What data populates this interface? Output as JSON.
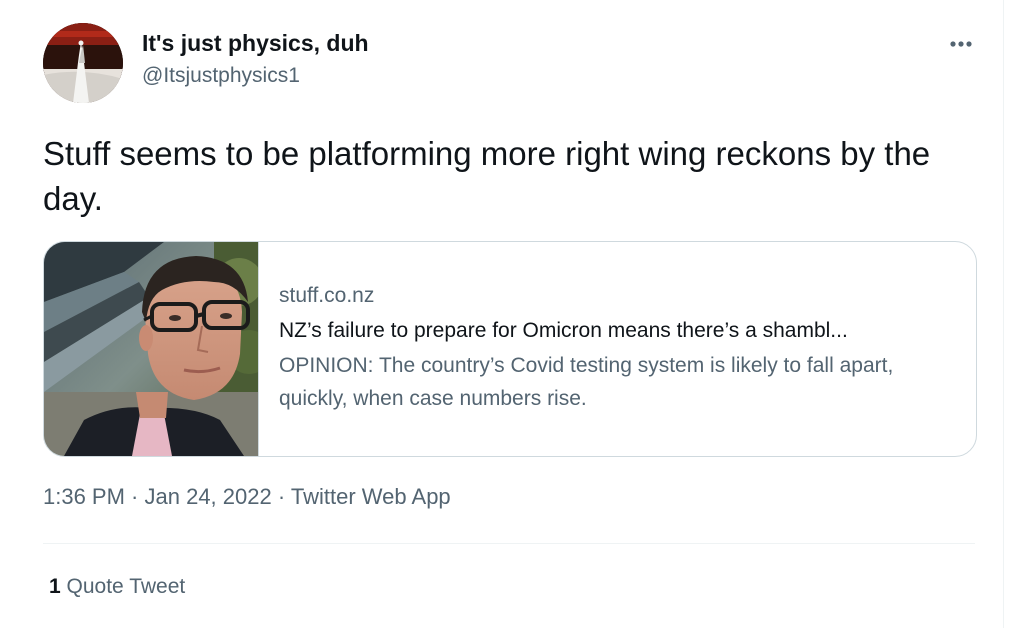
{
  "author": {
    "display_name": "It's just physics, duh",
    "handle": "@Itsjustphysics1"
  },
  "tweet": {
    "text": "Stuff seems to be platforming more right wing reckons by the day."
  },
  "link_card": {
    "domain": "stuff.co.nz",
    "title": "NZ’s failure to prepare for Omicron means there’s a shambl...",
    "description": "OPINION: The country’s Covid testing system is likely to fall apart, quickly, when case numbers rise."
  },
  "meta": {
    "time": "1:36 PM",
    "separator": " · ",
    "date": "Jan 24, 2022",
    "source": "Twitter Web App"
  },
  "stats": {
    "quote_count": "1",
    "quote_label": "Quote Tweet"
  },
  "colors": {
    "primary_text": "#0f1419",
    "secondary_text": "#536471",
    "border": "#cfd9de",
    "divider": "#eff3f4"
  },
  "icons": {
    "more": "more-horizontal-icon"
  }
}
